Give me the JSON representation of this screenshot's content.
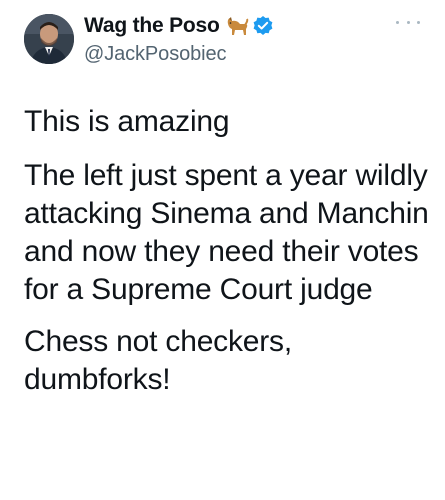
{
  "tweet": {
    "author": {
      "display_name": "Wag the Poso",
      "handle": "@JackPosobiec",
      "emoji_icon": "dog-emoji-icon",
      "verified_icon": "verified-badge-icon",
      "verified_color": "#1d9bf0"
    },
    "more_icon": "more-options-icon",
    "paragraphs": [
      "This is amazing",
      "The left just spent a year wildly attacking Sinema and Manchin and now they need their votes for a Supreme Court judge",
      "Chess not checkers, dumbforks!"
    ]
  }
}
